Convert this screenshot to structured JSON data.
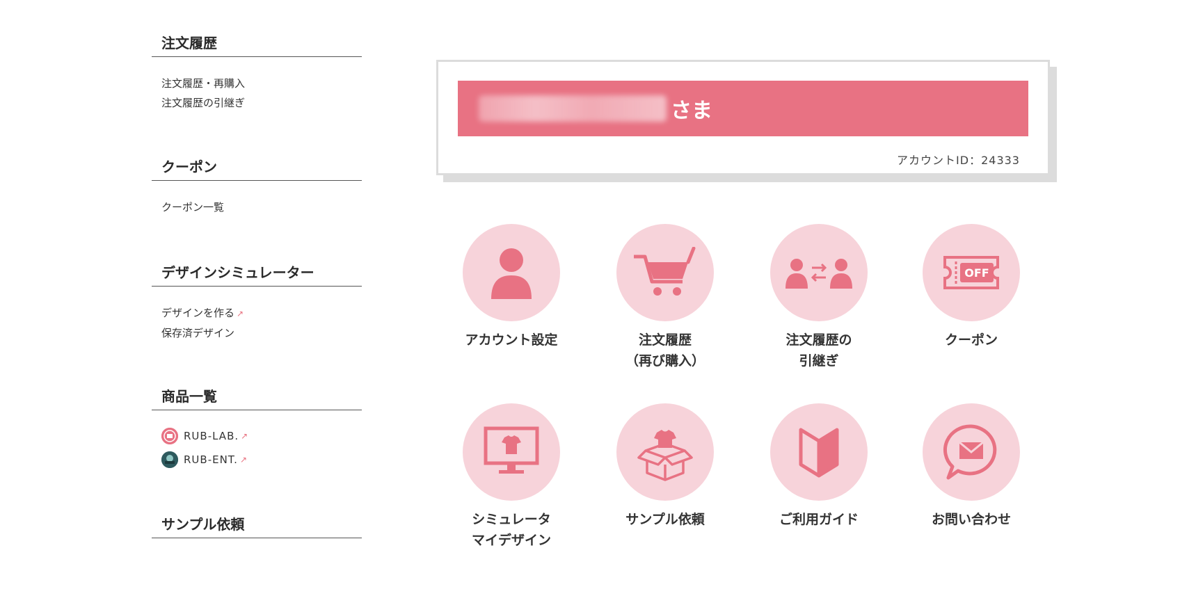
{
  "sidebar": {
    "sections": [
      {
        "title": "注文履歴",
        "links": [
          "注文履歴・再購入",
          "注文履歴の引継ぎ"
        ]
      },
      {
        "title": "クーポン",
        "links": [
          "クーポン一覧"
        ]
      },
      {
        "title": "デザインシミュレーター",
        "links": [
          "デザインを作る",
          "保存済デザイン"
        ]
      },
      {
        "title": "商品一覧",
        "brands": [
          "RUB-LAB.",
          "RUB-ENT."
        ]
      },
      {
        "title": "サンプル依頼"
      }
    ]
  },
  "account": {
    "name_suffix": "さま",
    "account_id": "アカウントID：24333"
  },
  "menu": [
    {
      "line1": "アカウント設定",
      "line2": "",
      "icon": "person-icon"
    },
    {
      "line1": "注文履歴",
      "line2": "（再び購入）",
      "icon": "cart-icon"
    },
    {
      "line1": "注文履歴の",
      "line2": "引継ぎ",
      "icon": "transfer-icon"
    },
    {
      "line1": "クーポン",
      "line2": "",
      "icon": "coupon-off-icon"
    },
    {
      "line1": "シミュレータ",
      "line2": "マイデザイン",
      "icon": "monitor-shirt-icon"
    },
    {
      "line1": "サンプル依頼",
      "line2": "",
      "icon": "box-shirt-icon"
    },
    {
      "line1": "ご利用ガイド",
      "line2": "",
      "icon": "beginner-mark-icon"
    },
    {
      "line1": "お問い合わせ",
      "line2": "",
      "icon": "mail-bubble-icon"
    }
  ],
  "colors": {
    "accent": "#e87283",
    "circle_bg": "#f7d3da",
    "text": "#333333"
  }
}
